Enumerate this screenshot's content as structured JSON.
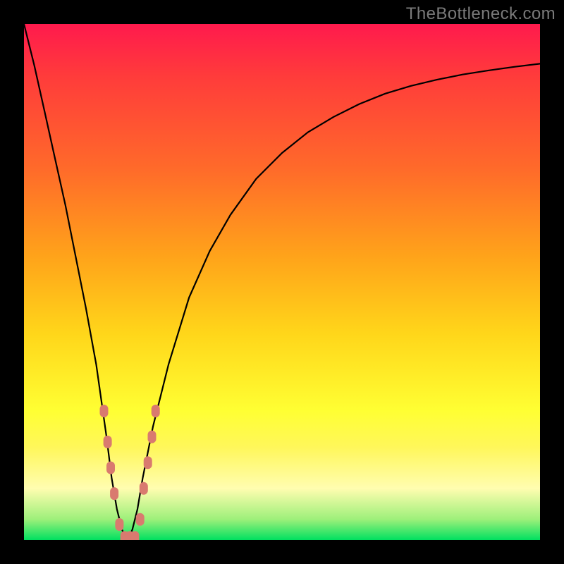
{
  "watermark": "TheBottleneck.com",
  "chart_data": {
    "type": "line",
    "title": "",
    "xlabel": "",
    "ylabel": "",
    "xlim": [
      0,
      100
    ],
    "ylim": [
      0,
      100
    ],
    "series": [
      {
        "name": "bottleneck-curve",
        "x": [
          0,
          2,
          4,
          6,
          8,
          10,
          12,
          14,
          16,
          17,
          18,
          19,
          20,
          21,
          22,
          23,
          25,
          28,
          32,
          36,
          40,
          45,
          50,
          55,
          60,
          65,
          70,
          75,
          80,
          85,
          90,
          95,
          100
        ],
        "y": [
          100,
          92,
          83,
          74,
          65,
          55,
          45,
          34,
          20,
          12,
          6,
          2,
          0,
          2,
          6,
          12,
          22,
          34,
          47,
          56,
          63,
          70,
          75,
          79,
          82,
          84.5,
          86.5,
          88,
          89.2,
          90.2,
          91,
          91.7,
          92.3
        ]
      }
    ],
    "markers": {
      "name": "highlighted-points",
      "color": "#d97a6f",
      "points": [
        {
          "x": 15.5,
          "y": 25
        },
        {
          "x": 16.2,
          "y": 19
        },
        {
          "x": 16.8,
          "y": 14
        },
        {
          "x": 17.5,
          "y": 9
        },
        {
          "x": 18.5,
          "y": 3
        },
        {
          "x": 19.5,
          "y": 0.5
        },
        {
          "x": 20.5,
          "y": 0.5
        },
        {
          "x": 21.5,
          "y": 0.5
        },
        {
          "x": 22.5,
          "y": 4
        },
        {
          "x": 23.2,
          "y": 10
        },
        {
          "x": 24.0,
          "y": 15
        },
        {
          "x": 24.8,
          "y": 20
        },
        {
          "x": 25.5,
          "y": 25
        }
      ]
    },
    "gradient_stops": [
      {
        "pos": 0,
        "color": "#ff1a4d"
      },
      {
        "pos": 10,
        "color": "#ff3b3b"
      },
      {
        "pos": 28,
        "color": "#ff6a2a"
      },
      {
        "pos": 45,
        "color": "#ffa31a"
      },
      {
        "pos": 60,
        "color": "#ffd61a"
      },
      {
        "pos": 75,
        "color": "#ffff33"
      },
      {
        "pos": 82,
        "color": "#fff75a"
      },
      {
        "pos": 90,
        "color": "#fffdb0"
      },
      {
        "pos": 96,
        "color": "#9df07a"
      },
      {
        "pos": 100,
        "color": "#00e060"
      }
    ]
  }
}
